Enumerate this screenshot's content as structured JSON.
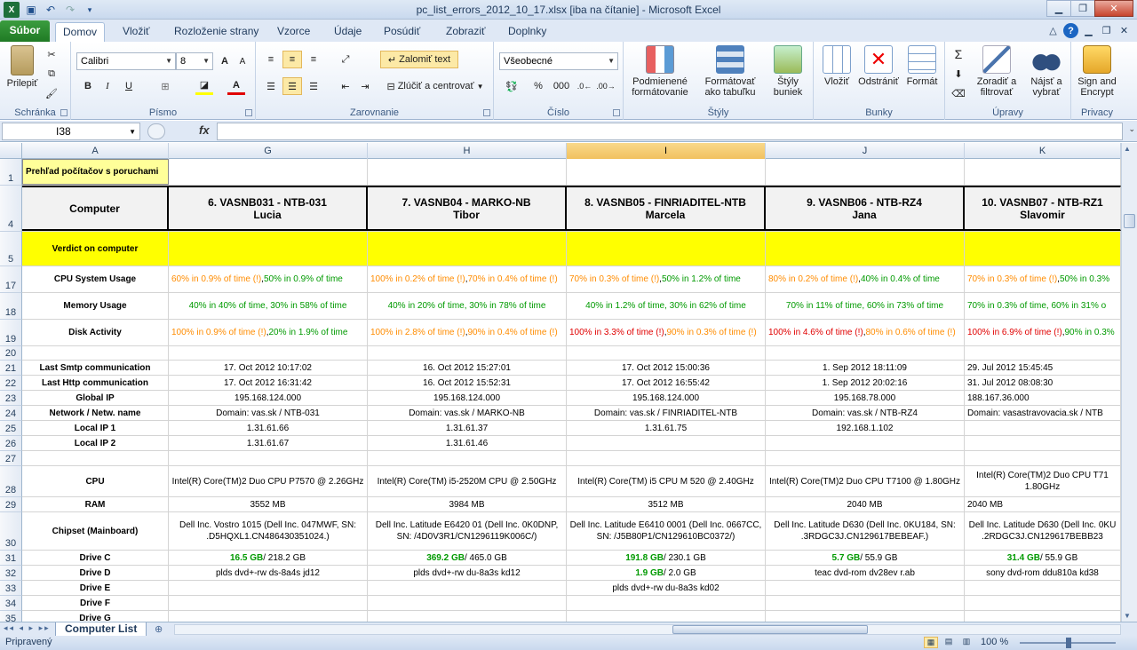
{
  "window": {
    "title": "pc_list_errors_2012_10_17.xlsx  [iba na čítanie]  -  Microsoft Excel"
  },
  "tabs": [
    "Súbor",
    "Domov",
    "Vložiť",
    "Rozloženie strany",
    "Vzorce",
    "Údaje",
    "Posúdiť",
    "Zobraziť",
    "Doplnky"
  ],
  "ribbon": {
    "clipboard": {
      "label": "Schránka",
      "paste": "Prilepiť"
    },
    "font": {
      "label": "Písmo",
      "name": "Calibri",
      "size": "8",
      "bold": "B",
      "italic": "I",
      "underline": "U"
    },
    "alignment": {
      "label": "Zarovnanie",
      "wrap": "Zalomiť text",
      "merge": "Zlúčiť a centrovať"
    },
    "number": {
      "label": "Číslo",
      "format": "Všeobecné",
      "percent": "%",
      "thousands": "000"
    },
    "styles": {
      "label": "Štýly",
      "conditional": "Podmienené formátovanie",
      "table": "Formátovať ako tabuľku",
      "cell": "Štýly buniek"
    },
    "cells": {
      "label": "Bunky",
      "insert": "Vložiť",
      "delete": "Odstrániť",
      "format": "Formát"
    },
    "editing": {
      "label": "Úpravy",
      "sigma": "Σ",
      "sort": "Zoradiť a filtrovať",
      "find": "Nájsť a vybrať"
    },
    "privacy": {
      "label": "Privacy",
      "sign": "Sign and Encrypt"
    }
  },
  "formula_bar": {
    "name_box": "I38",
    "fx": "fx",
    "value": ""
  },
  "columns": [
    "A",
    "G",
    "H",
    "I",
    "J",
    "K"
  ],
  "selected_column": "I",
  "rows": [
    "1",
    "4",
    "5",
    "17",
    "18",
    "19",
    "20",
    "21",
    "22",
    "23",
    "24",
    "25",
    "26",
    "27",
    "28",
    "29",
    "30",
    "31",
    "32",
    "33",
    "34",
    "35"
  ],
  "sheet": {
    "title": "Prehľad počítačov s poruchami",
    "computer_label": "Computer",
    "verdict_label": "Verdict on computer",
    "labels": {
      "cpu_usage": "CPU System Usage",
      "memory": "Memory Usage",
      "disk": "Disk Activity",
      "smtp": "Last Smtp communication",
      "http": "Last Http communication",
      "global_ip": "Global IP",
      "network": "Network / Netw. name",
      "local_ip1": "Local IP 1",
      "local_ip2": "Local IP 2",
      "cpu": "CPU",
      "ram": "RAM",
      "chipset": "Chipset (Mainboard)",
      "drive_c": "Drive C",
      "drive_d": "Drive D",
      "drive_e": "Drive E",
      "drive_f": "Drive F",
      "drive_g": "Drive G"
    },
    "computers": [
      {
        "name": "6. VASNB031 - NTB-031",
        "user": "Lucia",
        "cpu_a": "60% in 0.9% of time (!)",
        "cpu_sep": ", ",
        "cpu_b": "50% in 0.9% of time",
        "mem": "40% in 40% of time, 30% in 58% of time",
        "disk_a": "100% in 0.9% of time (!)",
        "disk_sep": ", ",
        "disk_b": "20% in 1.9% of time",
        "smtp": "17. Oct 2012 10:17:02",
        "http": "17. Oct 2012 16:31:42",
        "global_ip": "195.168.124.000",
        "network": "Domain: vas.sk / NTB-031",
        "local_ip1": "1.31.61.66",
        "local_ip2": "1.31.61.67",
        "cpu": "Intel(R) Core(TM)2 Duo CPU    P7570  @ 2.26GHz",
        "ram": "3552 MB",
        "chipset": "Dell Inc. Vostro 1015 (Dell Inc. 047MWF, SN: .D5HQXL1.CN486430351024.)",
        "drive_c_free": "16.5 GB",
        "drive_c_rest": " / 218.2 GB",
        "drive_d": "plds dvd+-rw ds-8a4s jd12",
        "drive_e": ""
      },
      {
        "name": "7. VASNB04 - MARKO-NB",
        "user": "Tibor",
        "cpu_a": "100% in 0.2% of time (!)",
        "cpu_sep": ", ",
        "cpu_b": "70% in 0.4% of time (!)",
        "mem": "40% in 20% of time, 30% in 78% of time",
        "disk_a": "100% in 2.8% of time (!)",
        "disk_sep": ", ",
        "disk_b": "90% in 0.4% of time (!)",
        "smtp": "16. Oct 2012 15:27:01",
        "http": "16. Oct 2012 15:52:31",
        "global_ip": "195.168.124.000",
        "network": "Domain: vas.sk / MARKO-NB",
        "local_ip1": "1.31.61.37",
        "local_ip2": "1.31.61.46",
        "cpu": "Intel(R) Core(TM) i5-2520M CPU @ 2.50GHz",
        "ram": "3984 MB",
        "chipset": "Dell Inc. Latitude E6420 01 (Dell Inc. 0K0DNP, SN: /4D0V3R1/CN1296119K006C/)",
        "drive_c_free": "369.2 GB",
        "drive_c_rest": " / 465.0 GB",
        "drive_d": "plds dvd+-rw du-8a3s kd12",
        "drive_e": ""
      },
      {
        "name": "8. VASNB05 - FINRIADITEL-NTB",
        "user": "Marcela",
        "cpu_a": "70% in 0.3% of time (!)",
        "cpu_sep": ", ",
        "cpu_b": "50% in 1.2% of time",
        "mem": "40% in 1.2% of time, 30% in 62% of time",
        "disk_a": "100% in 3.3% of time (!)",
        "disk_sep": ", ",
        "disk_b": "90% in 0.3% of time (!)",
        "smtp": "17. Oct 2012 15:00:36",
        "http": "17. Oct 2012 16:55:42",
        "global_ip": "195.168.124.000",
        "network": "Domain: vas.sk / FINRIADITEL-NTB",
        "local_ip1": "1.31.61.75",
        "local_ip2": "",
        "cpu": "Intel(R) Core(TM) i5 CPU       M 520  @ 2.40GHz",
        "ram": "3512 MB",
        "chipset": "Dell Inc. Latitude E6410 0001 (Dell Inc. 0667CC, SN: /J5B80P1/CN129610BC0372/)",
        "drive_c_free": "191.8 GB",
        "drive_c_rest": " / 230.1 GB",
        "drive_d_free": "1.9 GB",
        "drive_d_rest": " / 2.0 GB",
        "drive_e": "plds dvd+-rw du-8a3s kd02"
      },
      {
        "name": "9. VASNB06 - NTB-RZ4",
        "user": "Jana",
        "cpu_a": "80% in 0.2% of time (!)",
        "cpu_sep": ", ",
        "cpu_b": "40% in 0.4% of time",
        "mem": "70% in 11% of time, 60% in 73% of time",
        "disk_a": "100% in 4.6% of time (!)",
        "disk_sep": ", ",
        "disk_b": "80% in 0.6% of time (!)",
        "smtp": "1. Sep 2012 18:11:09",
        "http": "1. Sep 2012 20:02:16",
        "global_ip": "195.168.78.000",
        "network": "Domain: vas.sk / NTB-RZ4",
        "local_ip1": "192.168.1.102",
        "local_ip2": "",
        "cpu": "Intel(R) Core(TM)2 Duo CPU    T7100  @ 1.80GHz",
        "ram": "2040 MB",
        "chipset": "Dell Inc. Latitude D630 (Dell Inc. 0KU184, SN: .3RDGC3J.CN129617BEBEAF.)",
        "drive_c_free": "5.7 GB",
        "drive_c_rest": " / 55.9 GB",
        "drive_d": "teac dvd-rom dv28ev r.ab",
        "drive_e": ""
      },
      {
        "name": "10. VASNB07 - NTB-RZ1",
        "user": "Slavomir",
        "cpu_a": "70% in 0.3% of time (!)",
        "cpu_sep": ", ",
        "cpu_b": "50% in 0.3%",
        "mem": "70% in 0.3% of time, 60% in 31% o",
        "disk_a": "100% in 6.9% of time (!)",
        "disk_sep": ", ",
        "disk_b": "90% in 0.3%",
        "smtp": "29. Jul 2012 15:45:45",
        "http": "31. Jul 2012 08:08:30",
        "global_ip": "188.167.36.000",
        "network": "Domain: vasastravovacia.sk / NTB",
        "local_ip1": "",
        "local_ip2": "",
        "cpu": "Intel(R) Core(TM)2 Duo CPU    T71 1.80GHz",
        "ram": "2040 MB",
        "chipset": "Dell Inc. Latitude D630 (Dell Inc. 0KU .2RDGC3J.CN129617BEBB23",
        "drive_c_free": "31.4 GB",
        "drive_c_rest": " / 55.9 GB",
        "drive_d": "sony dvd-rom ddu810a kd38",
        "drive_e": ""
      }
    ]
  },
  "sheet_tab": "Computer List",
  "status": {
    "ready": "Pripravený",
    "zoom": "100 %"
  }
}
